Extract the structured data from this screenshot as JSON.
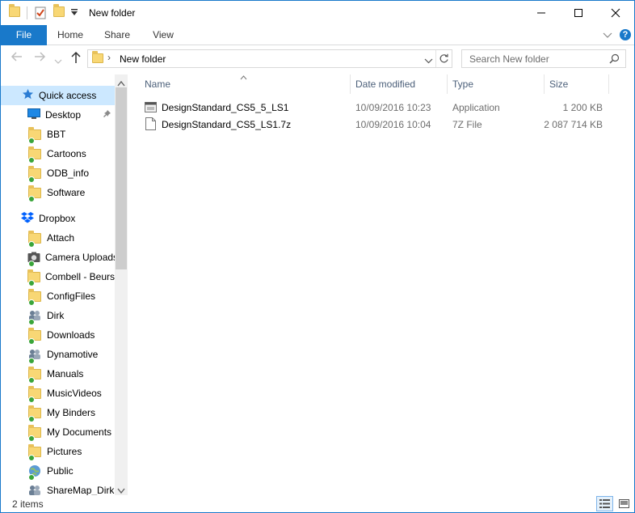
{
  "window": {
    "title": "New folder"
  },
  "ribbon": {
    "tabs": [
      {
        "label": "File"
      },
      {
        "label": "Home"
      },
      {
        "label": "Share"
      },
      {
        "label": "View"
      }
    ]
  },
  "address": {
    "path": "New folder",
    "search_placeholder": "Search New folder"
  },
  "nav": {
    "quick_access": "Quick access",
    "quick_items": [
      {
        "label": "Desktop"
      },
      {
        "label": "BBT"
      },
      {
        "label": "Cartoons"
      },
      {
        "label": "ODB_info"
      },
      {
        "label": "Software"
      }
    ],
    "dropbox": "Dropbox",
    "dropbox_items": [
      {
        "label": "Attach"
      },
      {
        "label": "Camera Uploads"
      },
      {
        "label": "Combell - Beurs"
      },
      {
        "label": "ConfigFiles"
      },
      {
        "label": "Dirk"
      },
      {
        "label": "Downloads"
      },
      {
        "label": "Dynamotive"
      },
      {
        "label": "Manuals"
      },
      {
        "label": "MusicVideos"
      },
      {
        "label": "My Binders"
      },
      {
        "label": "My Documents"
      },
      {
        "label": "Pictures"
      },
      {
        "label": "Public"
      },
      {
        "label": "ShareMap_Dirk"
      }
    ]
  },
  "files": {
    "columns": {
      "name": "Name",
      "date": "Date modified",
      "type": "Type",
      "size": "Size"
    },
    "rows": [
      {
        "name": "DesignStandard_CS5_5_LS1",
        "date": "10/09/2016 10:23",
        "type": "Application",
        "size": "1 200 KB"
      },
      {
        "name": "DesignStandard_CS5_LS1.7z",
        "date": "10/09/2016 10:04",
        "type": "7Z File",
        "size": "2 087 714 KB"
      }
    ]
  },
  "status": {
    "count": "2 items"
  },
  "colors": {
    "accent": "#1979ca",
    "selection": "#cce8ff",
    "folder": "#f8d775"
  }
}
